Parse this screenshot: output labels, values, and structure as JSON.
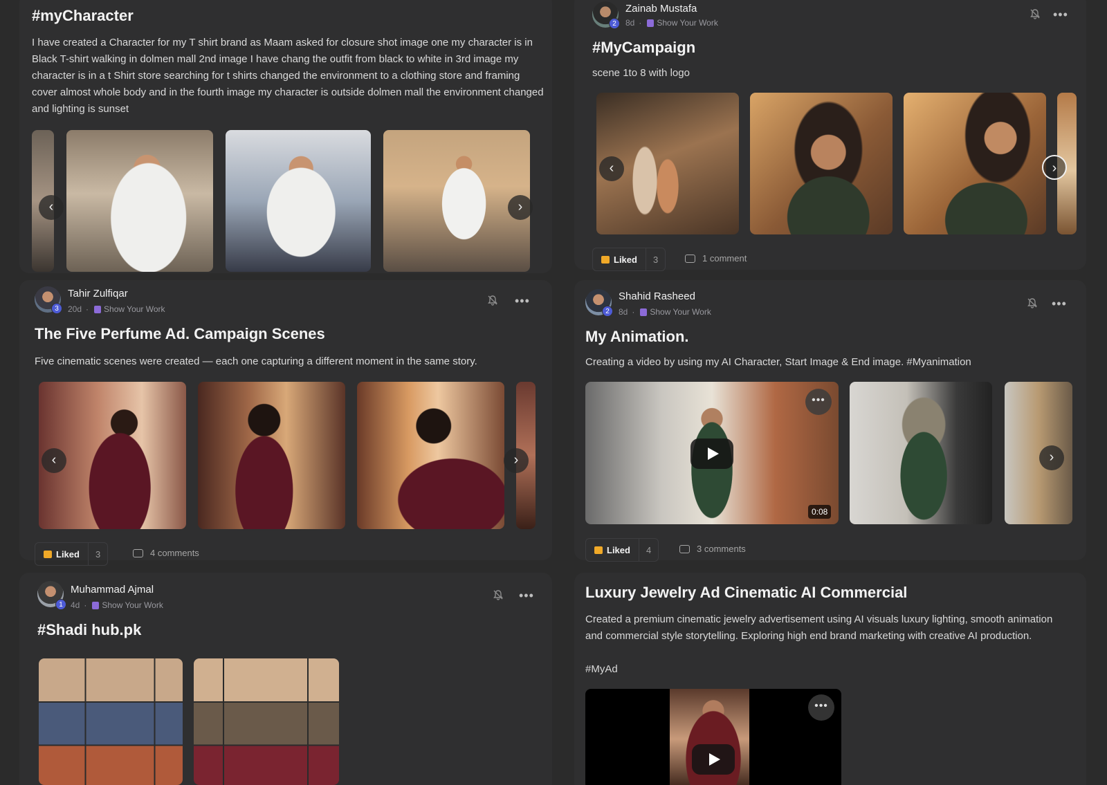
{
  "posts": [
    {
      "title": "#myCharacter",
      "description": "I have created a Character for my T shirt brand as Maam asked for closure shot image one my character is in Black T-shirt walking in dolmen mall 2nd image I have chang the outfit from black to white in 3rd image my character is in a t Shirt store searching for t shirts changed the environment to a clothing store and framing cover almost whole body and in the fourth image my character is outside dolmen mall the environment changed and lighting is sunset",
      "prev": "‹",
      "next": "›"
    },
    {
      "author": "Zainab Mustafa",
      "level": "2",
      "age": "8d",
      "category": "Show Your Work",
      "title": "#MyCampaign",
      "description": "scene 1to 8 with logo",
      "liked_label": "Liked",
      "likes": "3",
      "comments": "1 comment",
      "prev": "‹",
      "next": "›",
      "more": "•••"
    },
    {
      "author": "Tahir Zulfiqar",
      "level": "3",
      "age": "20d",
      "category": "Show Your Work",
      "title": "The Five Perfume Ad. Campaign Scenes",
      "description": "Five cinematic scenes were created — each one capturing a different moment in the same story.",
      "liked_label": "Liked",
      "likes": "3",
      "comments": "4 comments",
      "prev": "‹",
      "next": "›",
      "more": "•••"
    },
    {
      "author": "Shahid Rasheed",
      "level": "2",
      "age": "8d",
      "category": "Show Your Work",
      "title": "My Animation.",
      "description": "Creating a video by using my AI Character, Start Image & End image. #Myanimation",
      "liked_label": "Liked",
      "likes": "4",
      "comments": "3 comments",
      "duration": "0:08",
      "next": "›",
      "more": "•••"
    },
    {
      "author": "Muhammad Ajmal",
      "level": "1",
      "age": "4d",
      "category": "Show Your Work",
      "title": "#Shadi hub.pk",
      "more": "•••"
    },
    {
      "title": "Luxury Jewelry Ad Cinematic AI Commercial",
      "description": "Created a premium cinematic jewelry advertisement using AI visuals luxury lighting, smooth animation and commercial style storytelling. Exploring high end brand marketing with creative AI production.",
      "hashtag": "#MyAd",
      "more": "•••"
    }
  ],
  "colors": {
    "background": "#2b2b2b",
    "card": "#2f2f30",
    "accent_level": "#4d5bd6",
    "like_icon": "#f0a928",
    "category_icon": "#8c6bd8"
  }
}
